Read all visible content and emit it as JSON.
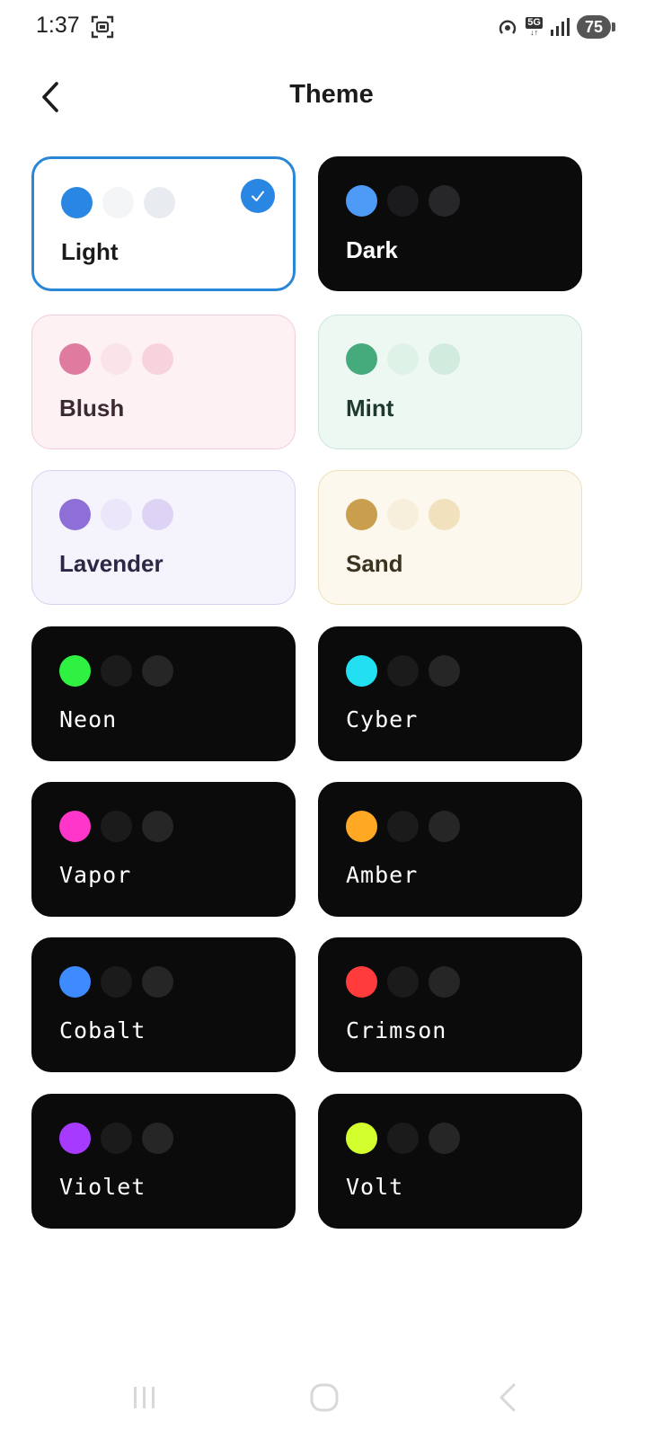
{
  "status": {
    "time": "1:37",
    "network": "5G",
    "battery": "75"
  },
  "header": {
    "title": "Theme"
  },
  "themes": [
    {
      "label": "Light",
      "selected": true,
      "bg": "#ffffff",
      "border": "#2a86d6",
      "text": "#1a1a1a",
      "dots": [
        "#2a86e3",
        "#f4f5f7",
        "#e8ebf0"
      ],
      "mono": false
    },
    {
      "label": "Dark",
      "selected": false,
      "bg": "#0b0b0b",
      "border": "#0b0b0b",
      "text": "#ffffff",
      "dots": [
        "#4d9bf7",
        "#1b1b1d",
        "#27272a"
      ],
      "mono": false
    },
    {
      "label": "Blush",
      "selected": false,
      "bg": "#fdf1f4",
      "border": "#f3cdd8",
      "text": "#3b2a2f",
      "dots": [
        "#e07ba0",
        "#fbe3ea",
        "#f7d3de"
      ],
      "mono": false
    },
    {
      "label": "Mint",
      "selected": false,
      "bg": "#eef8f3",
      "border": "#c9e6d8",
      "text": "#1e3a2e",
      "dots": [
        "#45aa7c",
        "#dff2e8",
        "#d1ebde"
      ],
      "mono": false
    },
    {
      "label": "Lavender",
      "selected": false,
      "bg": "#f5f3fc",
      "border": "#d9d0ee",
      "text": "#2c2744",
      "dots": [
        "#8e6fd8",
        "#ebe6f9",
        "#ddd3f4"
      ],
      "mono": false
    },
    {
      "label": "Sand",
      "selected": false,
      "bg": "#fcf8ee",
      "border": "#eedfb6",
      "text": "#3a331f",
      "dots": [
        "#c99e4c",
        "#f7efdc",
        "#f1e2bd"
      ],
      "mono": false
    },
    {
      "label": "Neon",
      "selected": false,
      "bg": "#0b0b0b",
      "border": "#0b0b0b",
      "text": "#ffffff",
      "dots": [
        "#2ef142",
        "#1b1b1b",
        "#262626"
      ],
      "mono": true
    },
    {
      "label": "Cyber",
      "selected": false,
      "bg": "#0b0b0b",
      "border": "#0b0b0b",
      "text": "#ffffff",
      "dots": [
        "#22e0f2",
        "#1b1b1b",
        "#262626"
      ],
      "mono": true
    },
    {
      "label": "Vapor",
      "selected": false,
      "bg": "#0b0b0b",
      "border": "#0b0b0b",
      "text": "#ffffff",
      "dots": [
        "#ff36c9",
        "#1b1b1b",
        "#262626"
      ],
      "mono": true
    },
    {
      "label": "Amber",
      "selected": false,
      "bg": "#0b0b0b",
      "border": "#0b0b0b",
      "text": "#ffffff",
      "dots": [
        "#ffa823",
        "#1b1b1b",
        "#262626"
      ],
      "mono": true
    },
    {
      "label": "Cobalt",
      "selected": false,
      "bg": "#0b0b0b",
      "border": "#0b0b0b",
      "text": "#ffffff",
      "dots": [
        "#3d8bff",
        "#1b1b1b",
        "#262626"
      ],
      "mono": true
    },
    {
      "label": "Crimson",
      "selected": false,
      "bg": "#0b0b0b",
      "border": "#0b0b0b",
      "text": "#ffffff",
      "dots": [
        "#ff3b3b",
        "#1b1b1b",
        "#262626"
      ],
      "mono": true
    },
    {
      "label": "Violet",
      "selected": false,
      "bg": "#0b0b0b",
      "border": "#0b0b0b",
      "text": "#ffffff",
      "dots": [
        "#a63bff",
        "#1b1b1b",
        "#262626"
      ],
      "mono": true
    },
    {
      "label": "Volt",
      "selected": false,
      "bg": "#0b0b0b",
      "border": "#0b0b0b",
      "text": "#ffffff",
      "dots": [
        "#d4ff2e",
        "#1b1b1b",
        "#262626"
      ],
      "mono": true
    }
  ],
  "icons": {
    "back": "back-arrow-icon",
    "check": "checkmark-icon",
    "nav_recent": "recent-apps-icon",
    "nav_home": "home-icon",
    "nav_back": "nav-back-icon"
  }
}
